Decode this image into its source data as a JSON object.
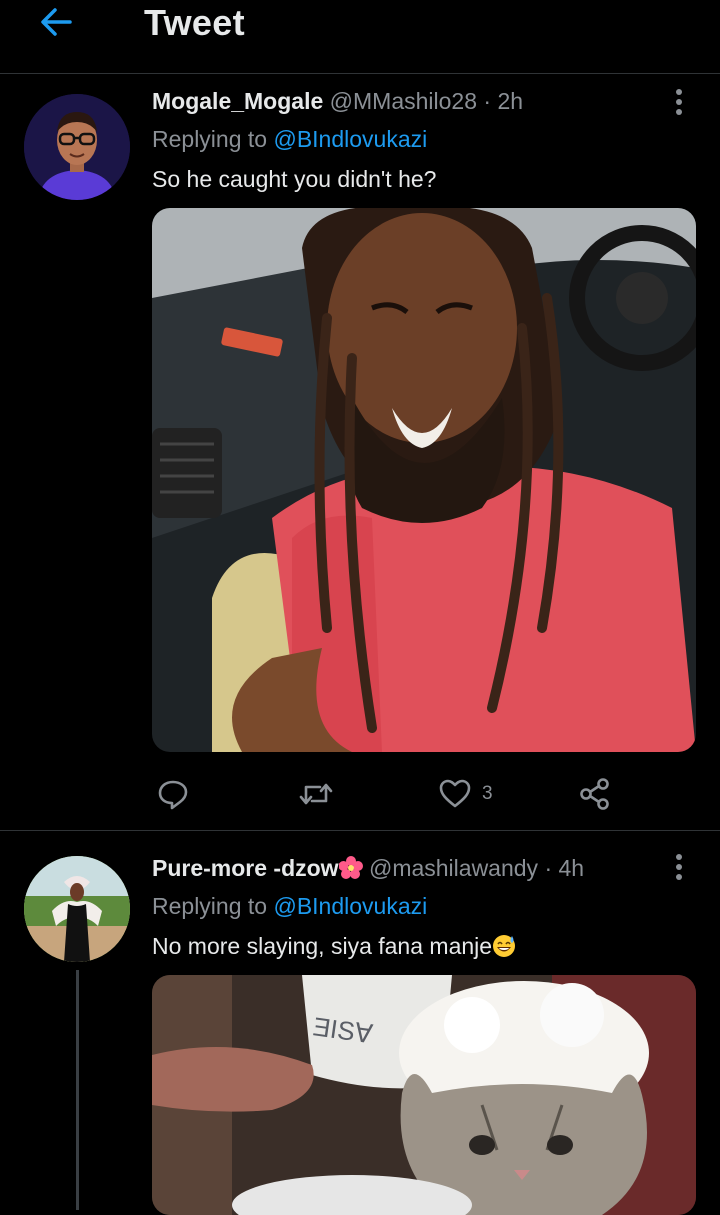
{
  "header": {
    "title": "Tweet",
    "back_icon": "arrow-left-icon"
  },
  "colors": {
    "accent": "#1d9bf0",
    "background": "#000000",
    "muted": "#8b9096",
    "text": "#e7e9ea"
  },
  "tweets": [
    {
      "name": "Mogale_Mogale",
      "handle": "@MMashilo28",
      "sep": "·",
      "time": "2h",
      "replying_prefix": "Replying to ",
      "replying_to": "@BIndlovukazi",
      "text": "So he caught you didn't he?",
      "media": "photo of a laughing man with long dreadlocks in a red t-shirt inside a car",
      "actions": {
        "reply_count": "",
        "retweet_count": "",
        "like_count": "3"
      }
    },
    {
      "name": "Pure-more -dzow",
      "name_emoji": "hibiscus-flower-icon",
      "handle": "@mashilawandy",
      "sep": "·",
      "time": "4h",
      "replying_prefix": "Replying to ",
      "replying_to": "@BIndlovukazi",
      "text": "No more slaying, siya fana manje",
      "text_emoji": "grinning-sweat-face-icon",
      "media": "photo of a sad kitten with soap foam on its head"
    }
  ]
}
